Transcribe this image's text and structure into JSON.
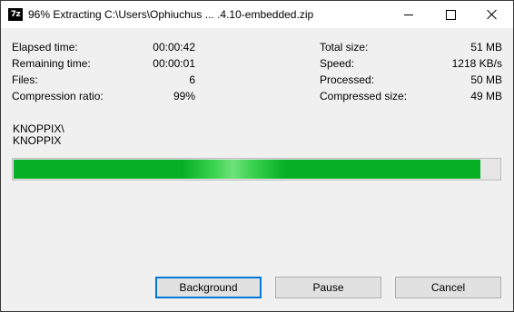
{
  "window": {
    "app_icon_text": "7z",
    "title": "96% Extracting C:\\Users\\Ophiuchus ... .4.10-embedded.zip"
  },
  "stats_left": [
    {
      "label": "Elapsed time:",
      "value": "00:00:42"
    },
    {
      "label": "Remaining time:",
      "value": "00:00:01"
    },
    {
      "label": "Files:",
      "value": "6"
    },
    {
      "label": "Compression ratio:",
      "value": "99%"
    }
  ],
  "stats_right": [
    {
      "label": "Total size:",
      "value": "51 MB"
    },
    {
      "label": "Speed:",
      "value": "1218 KB/s"
    },
    {
      "label": "Processed:",
      "value": "50 MB"
    },
    {
      "label": "Compressed size:",
      "value": "49 MB"
    }
  ],
  "current_path": {
    "line1": "KNOPPIX\\",
    "line2": "KNOPPIX"
  },
  "progress": {
    "percent": 96,
    "color": "#06b025"
  },
  "buttons": {
    "background": "Background",
    "pause": "Pause",
    "cancel": "Cancel"
  },
  "icons": [
    "7zip-app-icon",
    "minimize-icon",
    "maximize-icon",
    "close-icon"
  ]
}
